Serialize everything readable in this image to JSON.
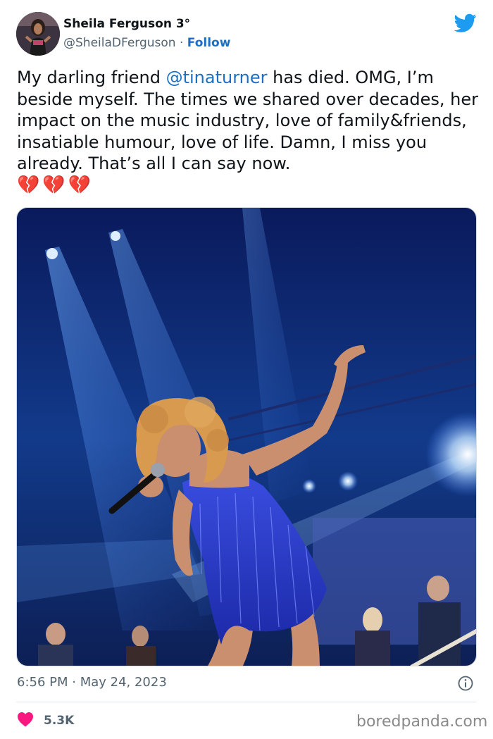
{
  "author": {
    "name": "Sheila Ferguson 3°",
    "handle": "@SheilaDFerguson",
    "separator": "·",
    "follow_label": "Follow"
  },
  "tweet": {
    "text_before": "My darling friend ",
    "mention": "@tinaturner",
    "text_after": " has died. OMG, I’m beside myself. The times we shared over decades, her impact on the music industry, love of family&friends, insatiable humour, love of life. Damn, I miss you already. That’s all I can say now.",
    "emojis": [
      "💔",
      "💔",
      "💔"
    ]
  },
  "photo": {
    "subject": "performer in blue fringe dress singing on stage"
  },
  "footer": {
    "timestamp": "6:56 PM · May 24, 2023",
    "like_count": "5.3K",
    "watermark": "boredpanda.com"
  },
  "icons": {
    "brand": "twitter-bird-icon",
    "info": "info-icon",
    "like": "heart-icon"
  },
  "colors": {
    "link": "#1d6fc4",
    "twitter_blue": "#1d9bf0",
    "heart": "#f91880",
    "muted": "#536471"
  }
}
